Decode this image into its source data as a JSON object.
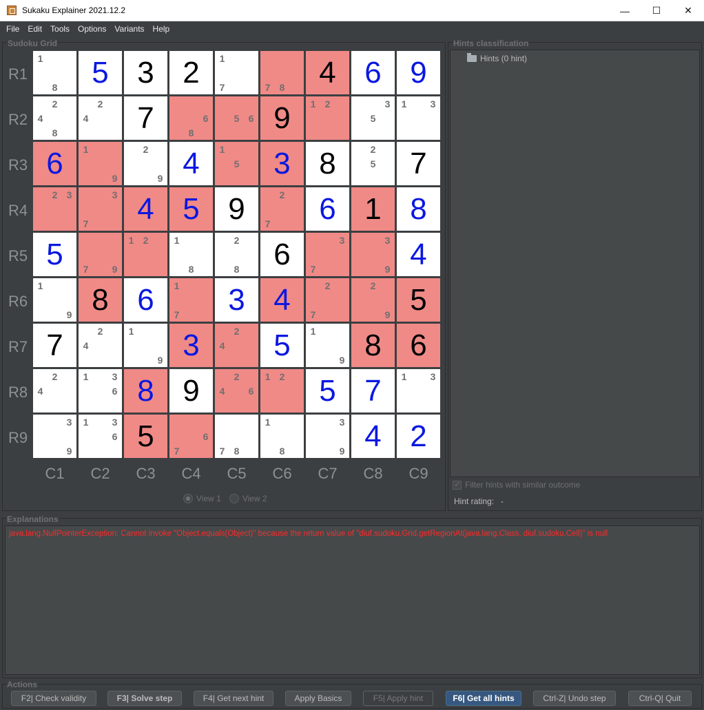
{
  "window": {
    "title": "Sukaku Explainer 2021.12.2",
    "minimize": "—",
    "maximize": "☐",
    "close": "✕"
  },
  "menu": [
    "File",
    "Edit",
    "Tools",
    "Options",
    "Variants",
    "Help"
  ],
  "sudoku_panel": {
    "title": "Sudoku Grid"
  },
  "rows": [
    "R1",
    "R2",
    "R3",
    "R4",
    "R5",
    "R6",
    "R7",
    "R8",
    "R9"
  ],
  "cols": [
    "C1",
    "C2",
    "C3",
    "C4",
    "C5",
    "C6",
    "C7",
    "C8",
    "C9"
  ],
  "grid": [
    [
      {
        "c": [
          1,
          8
        ]
      },
      {
        "v": "5",
        "t": "s"
      },
      {
        "v": "3",
        "t": "g"
      },
      {
        "v": "2",
        "t": "g"
      },
      {
        "c": [
          1,
          7
        ]
      },
      {
        "c": [
          7,
          8
        ],
        "h": 1
      },
      {
        "v": "4",
        "t": "g",
        "h": 1
      },
      {
        "v": "6",
        "t": "s"
      },
      {
        "v": "9",
        "t": "s"
      }
    ],
    [
      {
        "c": [
          2,
          4,
          8
        ]
      },
      {
        "c": [
          2,
          4
        ]
      },
      {
        "v": "7",
        "t": "g"
      },
      {
        "c": [
          6,
          8
        ],
        "h": 1
      },
      {
        "c": [
          5,
          6
        ],
        "h": 1
      },
      {
        "v": "9",
        "t": "g",
        "h": 1
      },
      {
        "c": [
          1,
          2
        ],
        "h": 1
      },
      {
        "c": [
          3,
          5
        ]
      },
      {
        "c": [
          1,
          3
        ]
      }
    ],
    [
      {
        "v": "6",
        "t": "s",
        "h": 1
      },
      {
        "c": [
          1,
          9
        ],
        "h": 1
      },
      {
        "c": [
          2,
          9
        ]
      },
      {
        "v": "4",
        "t": "s"
      },
      {
        "c": [
          1,
          5
        ],
        "h": 1
      },
      {
        "v": "3",
        "t": "s",
        "h": 1
      },
      {
        "v": "8",
        "t": "g"
      },
      {
        "c": [
          2,
          5
        ]
      },
      {
        "v": "7",
        "t": "g"
      }
    ],
    [
      {
        "c": [
          2,
          3
        ],
        "h": 1
      },
      {
        "c": [
          3,
          7
        ],
        "h": 1
      },
      {
        "v": "4",
        "t": "s",
        "h": 1
      },
      {
        "v": "5",
        "t": "s",
        "h": 1
      },
      {
        "v": "9",
        "t": "g"
      },
      {
        "c": [
          2,
          7
        ],
        "h": 1
      },
      {
        "v": "6",
        "t": "s"
      },
      {
        "v": "1",
        "t": "g",
        "h": 1
      },
      {
        "v": "8",
        "t": "s"
      }
    ],
    [
      {
        "v": "5",
        "t": "s"
      },
      {
        "c": [
          7,
          9
        ],
        "h": 1
      },
      {
        "c": [
          1,
          2
        ],
        "h": 1
      },
      {
        "c": [
          1,
          8
        ]
      },
      {
        "c": [
          2,
          8
        ]
      },
      {
        "v": "6",
        "t": "g"
      },
      {
        "c": [
          3,
          7
        ],
        "h": 1
      },
      {
        "c": [
          3,
          9
        ],
        "h": 1
      },
      {
        "v": "4",
        "t": "s"
      }
    ],
    [
      {
        "c": [
          1,
          9
        ]
      },
      {
        "v": "8",
        "t": "g",
        "h": 1
      },
      {
        "v": "6",
        "t": "s"
      },
      {
        "c": [
          1,
          7
        ],
        "h": 1
      },
      {
        "v": "3",
        "t": "s"
      },
      {
        "v": "4",
        "t": "s",
        "h": 1
      },
      {
        "c": [
          2,
          7
        ],
        "h": 1
      },
      {
        "c": [
          2,
          9
        ],
        "h": 1
      },
      {
        "v": "5",
        "t": "g",
        "h": 1
      }
    ],
    [
      {
        "v": "7",
        "t": "g"
      },
      {
        "c": [
          2,
          4
        ]
      },
      {
        "c": [
          1,
          9
        ]
      },
      {
        "v": "3",
        "t": "s",
        "h": 1
      },
      {
        "c": [
          2,
          4
        ],
        "h": 1
      },
      {
        "v": "5",
        "t": "s"
      },
      {
        "c": [
          1,
          9
        ]
      },
      {
        "v": "8",
        "t": "g",
        "h": 1
      },
      {
        "v": "6",
        "t": "g",
        "h": 1
      }
    ],
    [
      {
        "c": [
          2,
          4
        ]
      },
      {
        "c": [
          1,
          3,
          6
        ]
      },
      {
        "v": "8",
        "t": "s",
        "h": 1
      },
      {
        "v": "9",
        "t": "g"
      },
      {
        "c": [
          2,
          4,
          6
        ],
        "h": 1
      },
      {
        "c": [
          1,
          2
        ],
        "h": 1
      },
      {
        "v": "5",
        "t": "s"
      },
      {
        "v": "7",
        "t": "s"
      },
      {
        "c": [
          1,
          3
        ]
      }
    ],
    [
      {
        "c": [
          3,
          9
        ]
      },
      {
        "c": [
          1,
          3,
          6
        ]
      },
      {
        "v": "5",
        "t": "g",
        "h": 1
      },
      {
        "c": [
          6,
          7
        ],
        "h": 1
      },
      {
        "c": [
          7,
          8
        ]
      },
      {
        "c": [
          1,
          8
        ]
      },
      {
        "c": [
          3,
          9
        ]
      },
      {
        "v": "4",
        "t": "s"
      },
      {
        "v": "2",
        "t": "s"
      }
    ]
  ],
  "views": {
    "view1": "View 1",
    "view1_mn": "1",
    "view2": "View 2",
    "view2_mn": "2",
    "selected": "view1"
  },
  "hints_panel": {
    "title": "Hints classification",
    "tree_root": "Hints (0 hint)",
    "filter_label": "Filter hints with similar outcome",
    "filter_checked": true,
    "rating_label": "Hint rating:",
    "rating_value": "-"
  },
  "explanations": {
    "title": "Explanations",
    "message": "java.lang.NullPointerException: Cannot invoke \"Object.equals(Object)\" because the return value of \"diuf.sudoku.Grid.getRegionAt(java.lang.Class, diuf.sudoku.Cell)\" is null"
  },
  "actions": {
    "title": "Actions",
    "buttons": [
      {
        "label": "F2| Check validity",
        "style": "normal"
      },
      {
        "label": "F3| Solve step",
        "style": "bold"
      },
      {
        "label": "F4| Get next hint",
        "style": "normal"
      },
      {
        "label": "Apply Basics",
        "style": "normal"
      },
      {
        "label": "F5| Apply hint",
        "style": "disabled"
      },
      {
        "label": "F6| Get all hints",
        "style": "primary"
      },
      {
        "label": "Ctrl-Z| Undo step",
        "style": "normal"
      },
      {
        "label": "Ctrl-Q| Quit",
        "style": "normal"
      }
    ]
  },
  "colors": {
    "highlight": "#f08a87",
    "solved_digit": "#0a18e0",
    "given_digit": "#000000",
    "candidate": "#6f6f6f",
    "error": "#ff2a2a",
    "primary_button": "#365880"
  }
}
